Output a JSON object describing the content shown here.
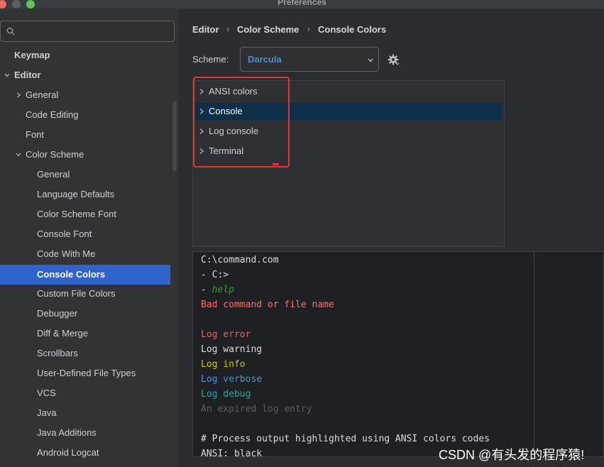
{
  "window": {
    "title": "Preferences"
  },
  "sidebar": {
    "search_placeholder": "",
    "items": [
      {
        "label": "Keymap"
      },
      {
        "label": "Editor"
      },
      {
        "label": "General"
      },
      {
        "label": "Code Editing"
      },
      {
        "label": "Font"
      },
      {
        "label": "Color Scheme"
      },
      {
        "label": "General"
      },
      {
        "label": "Language Defaults"
      },
      {
        "label": "Color Scheme Font"
      },
      {
        "label": "Console Font"
      },
      {
        "label": "Code With Me"
      },
      {
        "label": "Console Colors"
      },
      {
        "label": "Custom File Colors"
      },
      {
        "label": "Debugger"
      },
      {
        "label": "Diff & Merge"
      },
      {
        "label": "Scrollbars"
      },
      {
        "label": "User-Defined File Types"
      },
      {
        "label": "VCS"
      },
      {
        "label": "Java"
      },
      {
        "label": "Java Additions"
      },
      {
        "label": "Android Logcat"
      }
    ]
  },
  "breadcrumb": [
    "Editor",
    "Color Scheme",
    "Console Colors"
  ],
  "scheme": {
    "label": "Scheme:",
    "value": "Darcula"
  },
  "categories": [
    {
      "label": "ANSI colors"
    },
    {
      "label": "Console"
    },
    {
      "label": "Log console"
    },
    {
      "label": "Terminal"
    }
  ],
  "preview": {
    "lines": [
      {
        "text": "C:\\command.com",
        "color": "#d9dce0"
      },
      {
        "text": "- C:>",
        "color": "#d9dce0"
      },
      {
        "text": "help",
        "prefix": "- ",
        "color": "#3d9b3d",
        "italic": true
      },
      {
        "text": "Bad command or file name",
        "color": "#ff6b68"
      },
      {
        "text": "Log error",
        "color": "#cf6a6a"
      },
      {
        "text": "Log warning",
        "color": "#d9dce0"
      },
      {
        "text": "Log info",
        "color": "#c6c423"
      },
      {
        "text": "Log verbose",
        "color": "#4f8fe8"
      },
      {
        "text": "Log debug",
        "color": "#2ea3a3"
      },
      {
        "text": "An expired log entry",
        "color": "#5a5d61"
      },
      {
        "text": "# Process output highlighted using ANSI colors codes",
        "color": "#d9dce0"
      },
      {
        "text": "ANSI: black",
        "color": "#d9dce0"
      }
    ]
  },
  "watermark": "CSDN @有头发的程序猿!",
  "colors": {
    "accent": "#2f65ca",
    "annotation": "#e0382f"
  }
}
